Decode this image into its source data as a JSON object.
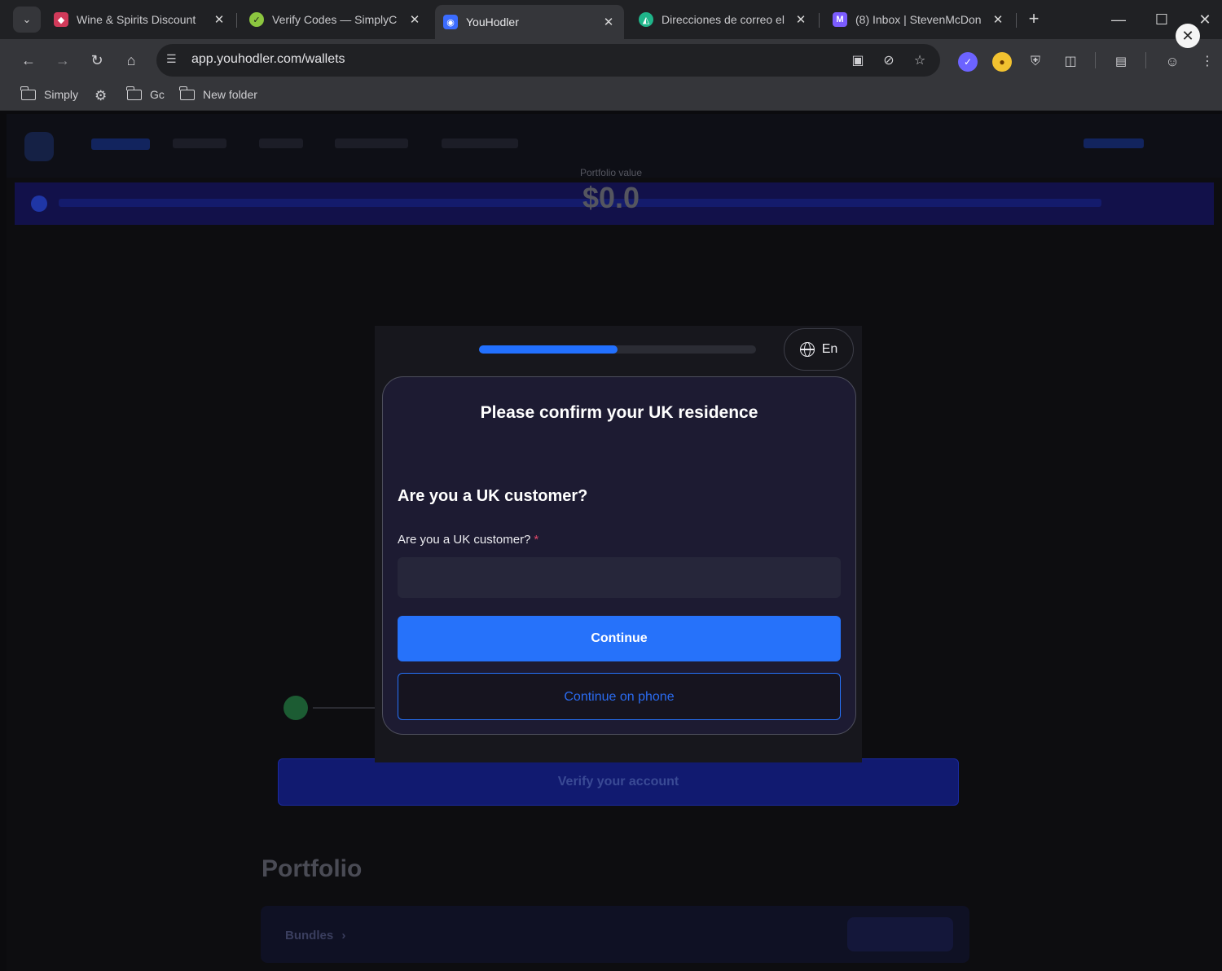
{
  "tabs": [
    {
      "title": "Wine & Spirits Discount",
      "favicon": "wine-favicon",
      "color": "#d13a5a"
    },
    {
      "title": "Verify Codes — SimplyC",
      "favicon": "check-favicon",
      "color": "#8cc63f"
    },
    {
      "title": "YouHodler",
      "favicon": "youhodler-favicon",
      "color": "#3b6cff",
      "active": true
    },
    {
      "title": "Direcciones de correo el",
      "favicon": "mail-favicon",
      "color": "#1fb58a"
    },
    {
      "title": "(8) Inbox | StevenMcDon",
      "favicon": "proton-favicon",
      "color": "#7b5cff"
    }
  ],
  "toolbar": {
    "url": "app.youhodler.com/wallets"
  },
  "bookmarks": [
    {
      "label": "Simply",
      "type": "folder"
    },
    {
      "label": "",
      "type": "gear"
    },
    {
      "label": "Gc",
      "type": "folder"
    },
    {
      "label": "New folder",
      "type": "folder"
    }
  ],
  "page": {
    "portfolio_value_label": "Portfolio value",
    "portfolio_value": "$0.0",
    "verify_button": "Verify your account",
    "portfolio_title": "Portfolio",
    "bundles_label": "Bundles"
  },
  "modal": {
    "progress": 0.5,
    "language": "En",
    "title": "Please confirm your UK residence",
    "question_heading": "Are you a UK customer?",
    "field_label": "Are you a UK customer?",
    "field_required_mark": "*",
    "field_value": "",
    "continue_label": "Continue",
    "continue_phone_label": "Continue on phone"
  },
  "colors": {
    "accent": "#2672fa",
    "card_bg": "#1d1b32"
  }
}
